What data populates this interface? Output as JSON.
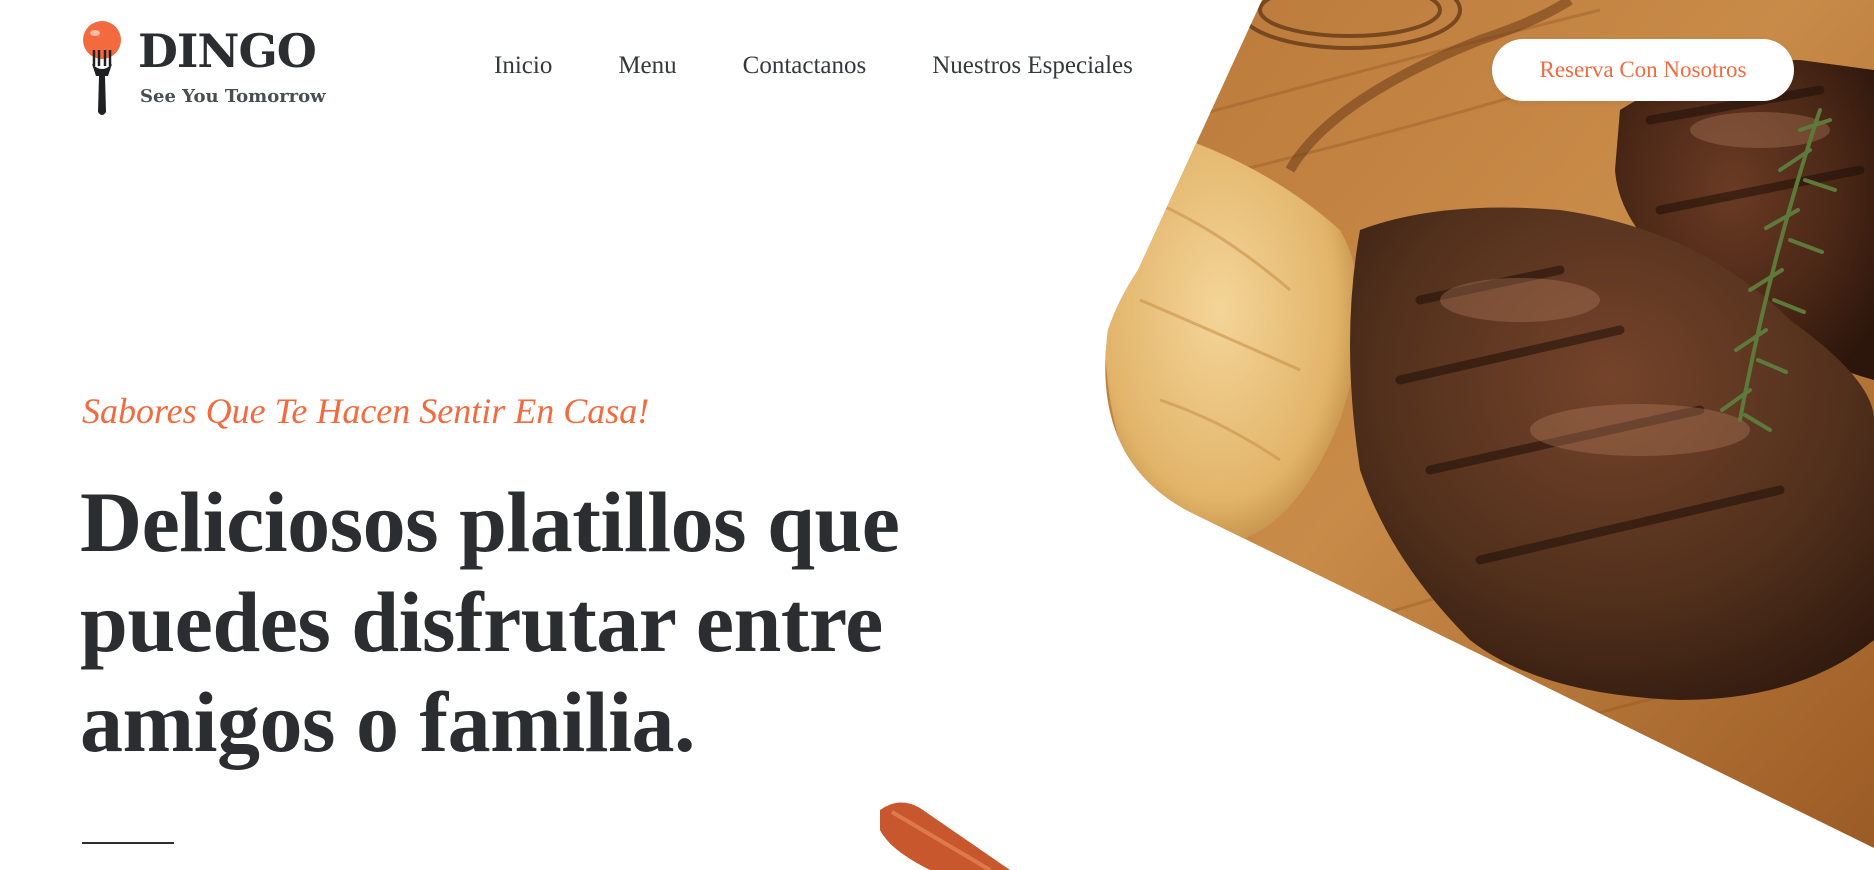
{
  "brand": {
    "name": "DINGO",
    "tagline": "See You Tomorrow",
    "logo_icon": "fork-with-tomato-icon"
  },
  "nav": {
    "items": [
      {
        "label": "Inicio"
      },
      {
        "label": "Menu"
      },
      {
        "label": "Contactanos"
      },
      {
        "label": "Nuestros Especiales"
      }
    ]
  },
  "cta": {
    "label": "Reserva Con Nosotros"
  },
  "hero": {
    "eyebrow": "Sabores Que Te Hacen Sentir En Casa!",
    "headline": "Deliciosos platillos que puedes disfrutar entre amigos o familia.",
    "image_icon": "grilled-steak-photo"
  },
  "colors": {
    "accent": "#f26a3d",
    "text": "#2b2d31",
    "background": "#ffffff"
  }
}
